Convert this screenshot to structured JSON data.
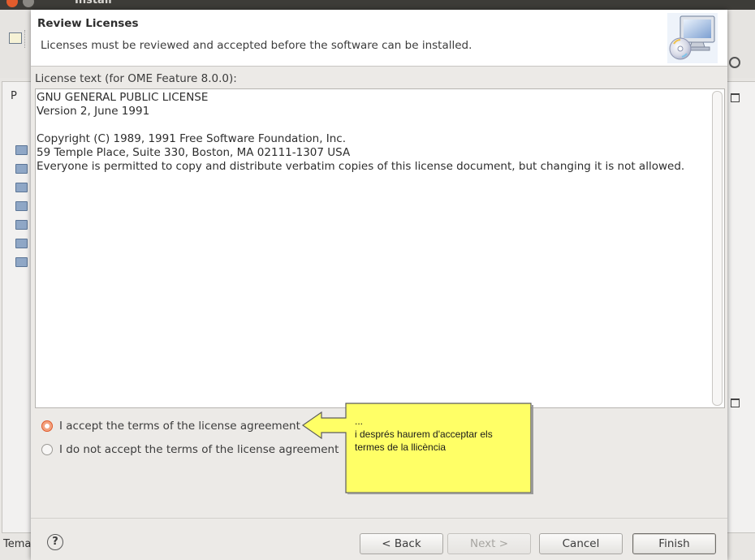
{
  "background": {
    "window_title": "Install",
    "panel_tab": "P",
    "status_text": "Tema"
  },
  "dialog": {
    "title": "Review Licenses",
    "description": "Licenses must be reviewed and accepted before the software can be installed.",
    "license_label": "License text (for OME Feature 8.0.0):",
    "license_text": "GNU GENERAL PUBLIC LICENSE\nVersion 2, June 1991\n\nCopyright (C) 1989, 1991 Free Software Foundation, Inc.\n59 Temple Place, Suite 330, Boston, MA 02111-1307 USA\nEveryone is permitted to copy and distribute verbatim copies of this license document, but changing it is not allowed.",
    "accept_label": "I accept the terms of the license agreement",
    "accept_selected": true,
    "decline_label": "I do not accept the terms of the license agreement",
    "buttons": {
      "help": "?",
      "back": "< Back",
      "next": "Next >",
      "cancel": "Cancel",
      "finish": "Finish"
    }
  },
  "callout": {
    "lines": [
      "...",
      "i després haurem d'acceptar els",
      "termes de la llicència"
    ],
    "fill_color": "#ffff66"
  },
  "colors": {
    "accent": "#e05a2b"
  }
}
